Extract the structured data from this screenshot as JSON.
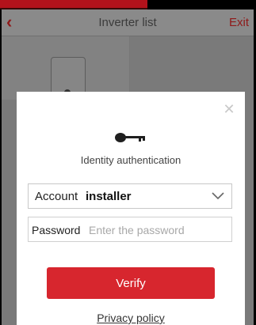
{
  "header": {
    "back_icon": "chevron-left-icon",
    "title": "Inverter list",
    "exit_label": "Exit"
  },
  "dialog": {
    "close_icon": "close-icon",
    "key_icon": "key-icon",
    "title": "Identity authentication",
    "account": {
      "label": "Account",
      "value": "installer",
      "dropdown_icon": "chevron-down-icon"
    },
    "password": {
      "label": "Password",
      "placeholder": "Enter the password",
      "value": ""
    },
    "verify_label": "Verify",
    "privacy_label": "Privacy policy"
  },
  "colors": {
    "accent": "#d7262e",
    "banner": "#b3121b",
    "overlay": "#7a7a7a"
  }
}
